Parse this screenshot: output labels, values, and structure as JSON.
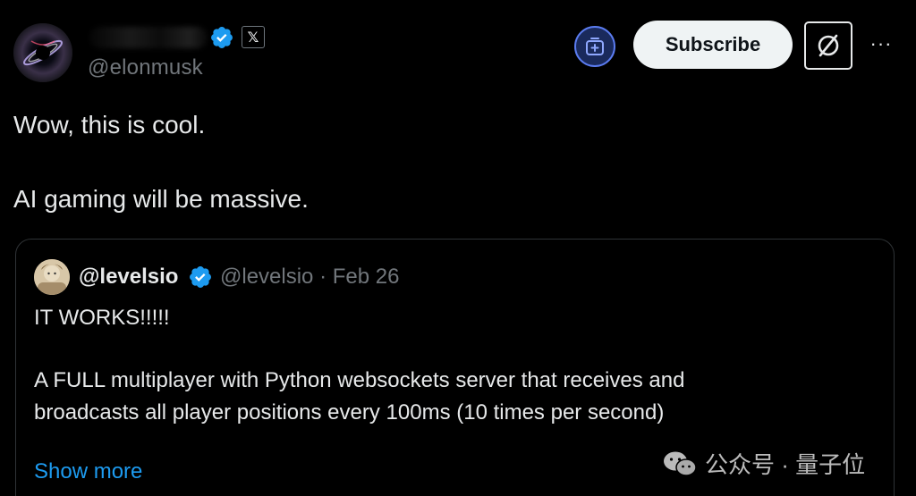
{
  "author": {
    "handle": "@elonmusk",
    "verified": true,
    "x_badge": "𝕏",
    "avatar_icon": "black-hole-avatar"
  },
  "actions": {
    "grok_icon": "grok-add-icon",
    "subscribe_label": "Subscribe",
    "grok_square_icon": "grok-logo-icon",
    "more_label": "···"
  },
  "tweet": {
    "line1": "Wow, this is cool.",
    "line2": "AI gaming will be massive."
  },
  "quote": {
    "name": "@levelsio",
    "handle_meta": "@levelsio · Feb 26",
    "line1": "IT WORKS!!!!!",
    "line2": "A FULL multiplayer with Python websockets server that receives and",
    "line3": "broadcasts all player positions every 100ms (10 times per second)",
    "show_more": "Show more"
  },
  "watermark": {
    "text": "公众号 · 量子位",
    "icon": "wechat-icon"
  },
  "colors": {
    "background": "#000000",
    "text": "#e7e9ea",
    "muted": "#71767b",
    "link": "#1d9bf0",
    "verified": "#1d9bf0",
    "border": "#2f3336"
  }
}
